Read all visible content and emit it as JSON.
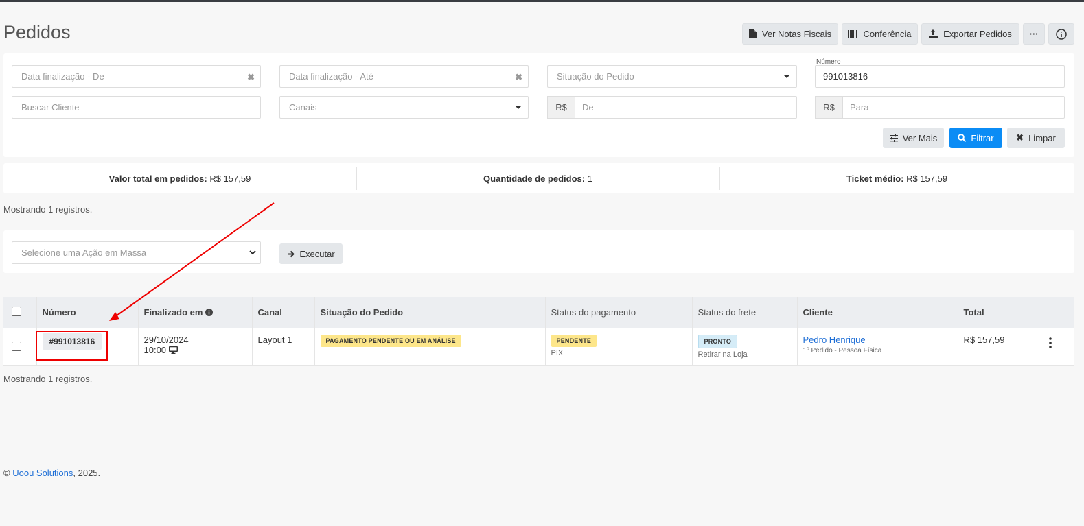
{
  "header": {
    "title": "Pedidos",
    "buttons": {
      "notas": "Ver Notas Fiscais",
      "conferencia": "Conferência",
      "exportar": "Exportar Pedidos",
      "more": "···",
      "info": "i"
    }
  },
  "filters": {
    "data_de_placeholder": "Data finalização - De",
    "data_ate_placeholder": "Data finalização - Até",
    "situacao_placeholder": "Situação do Pedido",
    "numero_label": "Número",
    "numero_value": "991013816",
    "cliente_placeholder": "Buscar Cliente",
    "canais_placeholder": "Canais",
    "currency": "R$",
    "valor_de_placeholder": "De",
    "valor_para_placeholder": "Para",
    "ver_mais": "Ver Mais",
    "filtrar": "Filtrar",
    "limpar": "Limpar",
    "clear_glyph": "✖"
  },
  "stats": {
    "valor_total_label": "Valor total em pedidos:",
    "valor_total": "R$ 157,59",
    "quantidade_label": "Quantidade de pedidos:",
    "quantidade": "1",
    "ticket_label": "Ticket médio:",
    "ticket": "R$ 157,59"
  },
  "showing_top": "Mostrando 1 registros.",
  "bulk": {
    "select_placeholder": "Selecione uma Ação em Massa",
    "executar": "Executar"
  },
  "table": {
    "headers": {
      "numero": "Número",
      "finalizado": "Finalizado em",
      "canal": "Canal",
      "situacao": "Situação do Pedido",
      "status_pagamento": "Status do pagamento",
      "status_frete": "Status do frete",
      "cliente": "Cliente",
      "total": "Total"
    },
    "rows": [
      {
        "numero": "#991013816",
        "data": "29/10/2024",
        "hora": "10:00",
        "canal": "Layout 1",
        "situacao": "PAGAMENTO PENDENTE OU EM ANÁLISE",
        "pagamento_status": "PENDENTE",
        "pagamento_metodo": "PIX",
        "frete_status": "PRONTO",
        "frete_metodo": "Retirar na Loja",
        "cliente_nome": "Pedro Henrique",
        "cliente_info": "1º Pedido - Pessoa Física",
        "total": "R$ 157,59"
      }
    ]
  },
  "showing_bottom": "Mostrando 1 registros.",
  "footer": {
    "copyright": "©",
    "company": "Uoou Solutions",
    "year": ", 2025."
  },
  "colors": {
    "primary": "#0b8cf5",
    "annotation": "#e00000",
    "link": "#1f6fd6"
  }
}
